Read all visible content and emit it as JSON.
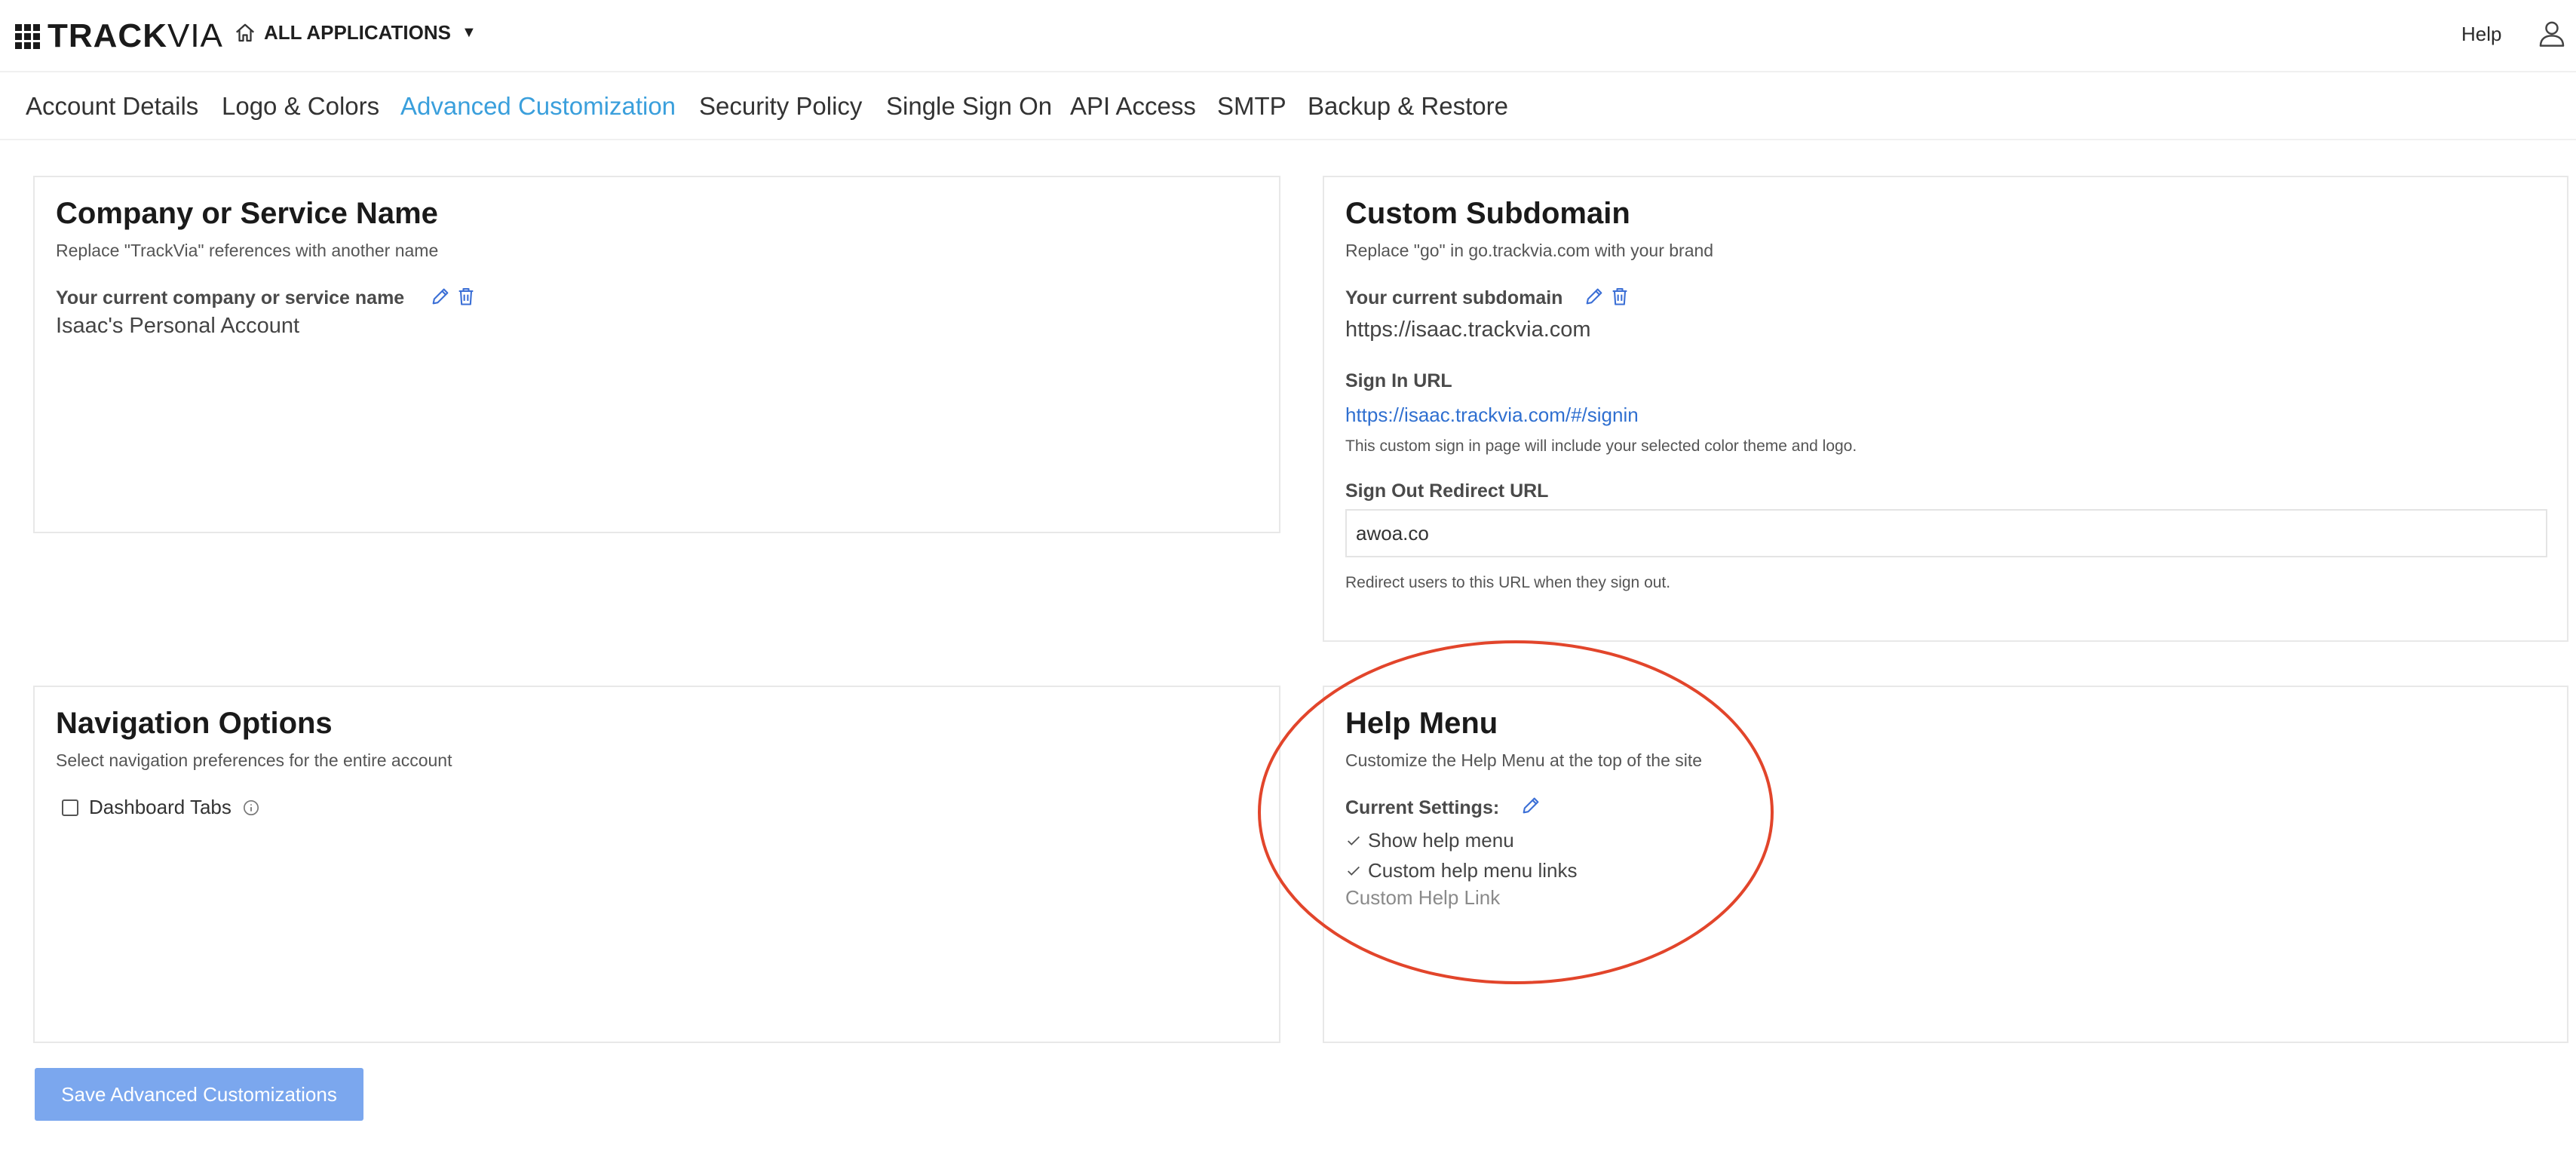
{
  "header": {
    "logo_text_bold": "TRACK",
    "logo_text_light": "VIA",
    "apps_label": "ALL APPLICATIONS",
    "help_label": "Help",
    "icons": [
      "logo-grid",
      "home-icon",
      "caret-down-icon",
      "user-icon"
    ]
  },
  "tabs": [
    {
      "label": "Account Details",
      "active": false
    },
    {
      "label": "Logo & Colors",
      "active": false
    },
    {
      "label": "Advanced Customization",
      "active": true
    },
    {
      "label": "Security Policy",
      "active": false
    },
    {
      "label": "Single Sign On",
      "active": false
    },
    {
      "label": "API Access",
      "active": false
    },
    {
      "label": "SMTP",
      "active": false
    },
    {
      "label": "Backup & Restore",
      "active": false
    }
  ],
  "company_card": {
    "title": "Company or Service Name",
    "subtitle": "Replace \"TrackVia\" references with another name",
    "label": "Your current company or service name",
    "value": "Isaac's Personal Account"
  },
  "subdomain_card": {
    "title": "Custom Subdomain",
    "subtitle": "Replace \"go\" in go.trackvia.com with your brand",
    "current_label": "Your current subdomain",
    "current_value": "https://isaac.trackvia.com",
    "signin_label": "Sign In URL",
    "signin_url": "https://isaac.trackvia.com/#/signin",
    "signin_note": "This custom sign in page will include your selected color theme and logo.",
    "signout_label": "Sign Out Redirect URL",
    "signout_value": "awoa.co",
    "signout_note": "Redirect users to this URL when they sign out."
  },
  "navigation_card": {
    "title": "Navigation Options",
    "subtitle": "Select navigation preferences for the entire account",
    "dashboard_tabs_label": "Dashboard Tabs",
    "dashboard_tabs_checked": false
  },
  "help_card": {
    "title": "Help Menu",
    "subtitle": "Customize the Help Menu at the top of the site",
    "settings_label": "Current Settings:",
    "settings": [
      "Show help menu",
      "Custom help menu links"
    ],
    "custom_link": "Custom Help Link"
  },
  "footer": {
    "save_label": "Save Advanced Customizations"
  },
  "colors": {
    "accent_active_tab": "#3a9fdc",
    "link": "#2f6fd0",
    "icon_blue": "#3b6fd6",
    "save_button": "#7ba7ee",
    "annotation": "#e2452b"
  }
}
